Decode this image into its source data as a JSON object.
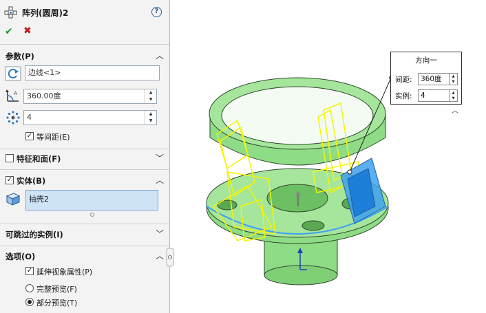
{
  "panel": {
    "title": "阵列(圆周)2",
    "params": {
      "label": "参数(P)",
      "direction_ref": "边线<1>",
      "angle": "360.00度",
      "count": "4",
      "equal_spacing_label": "等间距(E)",
      "equal_spacing_checked": true
    },
    "features": {
      "label": "特征和面(F)",
      "checked": false
    },
    "bodies": {
      "label": "实体(B)",
      "checked": true,
      "selected": "抽壳2"
    },
    "skip": {
      "label": "可跳过的实例(I)"
    },
    "options": {
      "label": "选项(O)",
      "propagate_label": "延伸视象属性(P)",
      "propagate_checked": true,
      "full_preview_label": "完整预览(F)",
      "partial_preview_label": "部分预览(T)",
      "selected_preview": "partial"
    }
  },
  "callout": {
    "title": "方向一",
    "spacing_label": "间距:",
    "spacing_value": "360度",
    "instances_label": "实例:",
    "instances_value": "4"
  },
  "colors": {
    "model_green": "#8fdc86",
    "model_edge": "#2e4a2c",
    "pattern_yellow": "#f5f500",
    "selected_blue": "#3ea0ef",
    "check_green": "#1f9a2a",
    "cancel_red": "#c21a1a"
  },
  "icons": [
    "circular-pattern-icon",
    "help-icon",
    "check-icon",
    "close-icon",
    "direction-icon",
    "angle-icon",
    "instances-icon",
    "body-icon",
    "chevron-up-icon",
    "chevron-down-icon"
  ]
}
